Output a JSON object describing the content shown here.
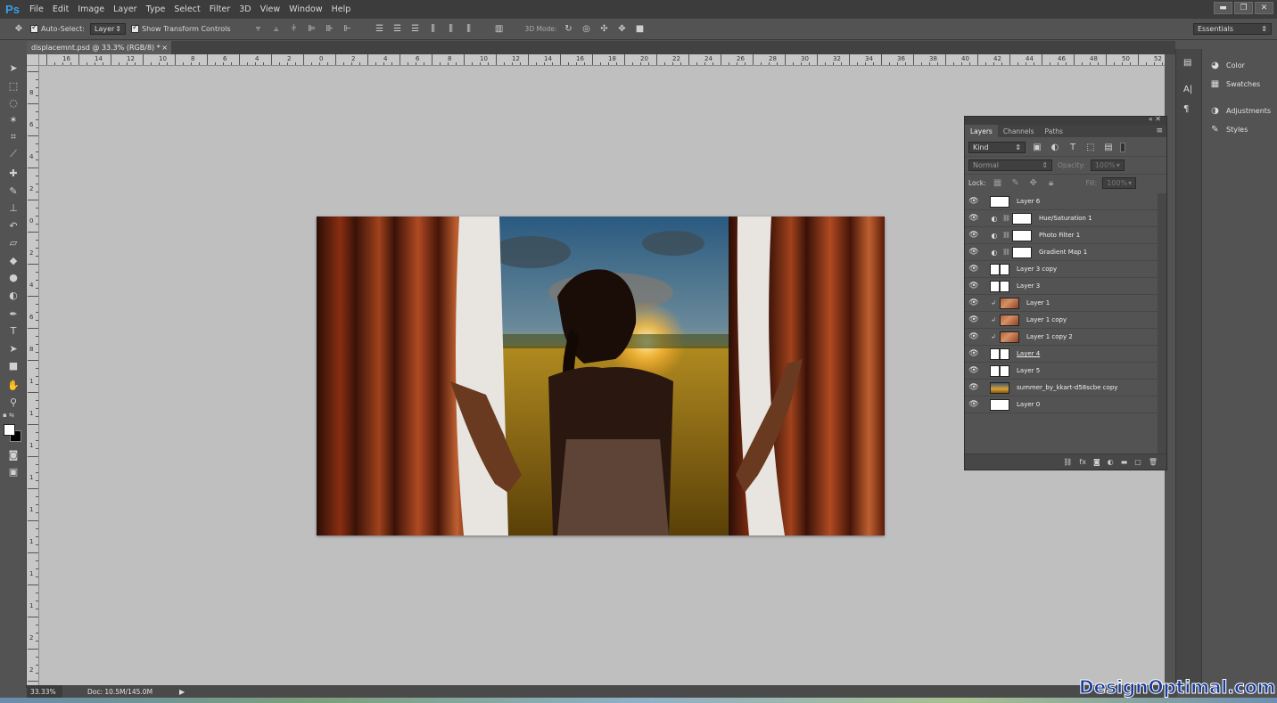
{
  "app": {
    "logo": "Ps",
    "menu": [
      "File",
      "Edit",
      "Image",
      "Layer",
      "Type",
      "Select",
      "Filter",
      "3D",
      "View",
      "Window",
      "Help"
    ]
  },
  "window_controls": [
    "▬",
    "❐",
    "✕"
  ],
  "options_bar": {
    "auto_select_label": "Auto-Select:",
    "auto_select_value": "Layer",
    "show_transform_label": "Show Transform Controls",
    "mode_3d_label": "3D Mode:",
    "workspace": "Essentials"
  },
  "document": {
    "tab_title": "displacemnt.psd @ 33.3% (RGB/8) *",
    "tab_close": "×"
  },
  "ruler_top_ticks": [
    "16",
    "14",
    "12",
    "10",
    "8",
    "6",
    "4",
    "2",
    "0",
    "2",
    "4",
    "6",
    "8",
    "10",
    "12",
    "14",
    "16",
    "18",
    "20",
    "22",
    "24",
    "26",
    "28",
    "30",
    "32",
    "34",
    "36",
    "38",
    "40",
    "42",
    "44",
    "46",
    "48",
    "50",
    "52"
  ],
  "ruler_left_ticks": [
    "8",
    "6",
    "4",
    "2",
    "0",
    "2",
    "4",
    "6",
    "8",
    "1",
    "1",
    "1",
    "1",
    "1",
    "1",
    "1",
    "1",
    "2",
    "2"
  ],
  "status": {
    "zoom": "33.33%",
    "doc": "Doc: 10.5M/145.0M"
  },
  "right_dock": {
    "items": [
      {
        "label": "Color",
        "icon": "palette-icon"
      },
      {
        "label": "Swatches",
        "icon": "grid-icon"
      },
      {
        "label": "Adjustments",
        "icon": "adjust-icon"
      },
      {
        "label": "Styles",
        "icon": "styles-icon"
      }
    ]
  },
  "layers_panel": {
    "tabs": [
      "Layers",
      "Channels",
      "Paths"
    ],
    "filter_kind": "Kind",
    "blend_mode": "Normal",
    "opacity_label": "Opacity:",
    "opacity_value": "100%",
    "lock_label": "Lock:",
    "fill_label": "Fill:",
    "fill_value": "100%",
    "layers": [
      {
        "name": "Layer 6",
        "type": "white"
      },
      {
        "name": "Hue/Saturation 1",
        "type": "adjustment"
      },
      {
        "name": "Photo Filter 1",
        "type": "adjustment"
      },
      {
        "name": "Gradient Map 1",
        "type": "adjustment"
      },
      {
        "name": "Layer 3 copy",
        "type": "pair"
      },
      {
        "name": "Layer 3",
        "type": "pair"
      },
      {
        "name": "Layer 1",
        "type": "brick-clip"
      },
      {
        "name": "Layer 1 copy",
        "type": "brick-clip"
      },
      {
        "name": "Layer 1 copy 2",
        "type": "brick-clip"
      },
      {
        "name": "Layer 4",
        "type": "pair"
      },
      {
        "name": "Layer 5",
        "type": "pair"
      },
      {
        "name": "summer_by_kkart-d58scbe copy",
        "type": "gold"
      },
      {
        "name": "Layer 0",
        "type": "white"
      }
    ]
  },
  "watermark": "DesignOptimal.com"
}
